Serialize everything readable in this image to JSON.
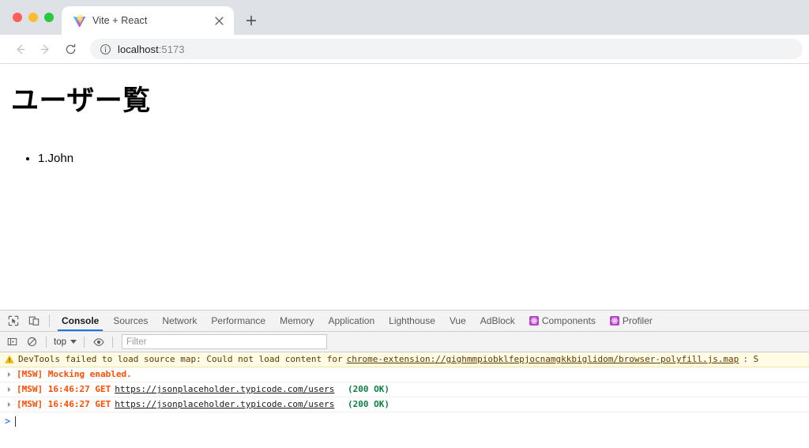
{
  "browser": {
    "traffic_lights": [
      "close",
      "minimize",
      "maximize"
    ],
    "tab": {
      "title": "Vite + React",
      "favicon": "vite-logo-icon",
      "close_label": "×"
    },
    "new_tab_label": "+",
    "nav": {
      "back": "back-arrow",
      "forward": "forward-arrow",
      "reload": "reload-arrow"
    },
    "omnibox": {
      "host": "localhost",
      "port": ":5173",
      "info_icon": "info-circle-icon"
    }
  },
  "page": {
    "title": "ユーザー覧",
    "users": [
      "1.John"
    ]
  },
  "devtools": {
    "left_icons": [
      "inspect-element-icon",
      "device-toolbar-icon"
    ],
    "tabs": [
      {
        "label": "Console",
        "active": true,
        "ext_icon": false
      },
      {
        "label": "Sources",
        "active": false,
        "ext_icon": false
      },
      {
        "label": "Network",
        "active": false,
        "ext_icon": false
      },
      {
        "label": "Performance",
        "active": false,
        "ext_icon": false
      },
      {
        "label": "Memory",
        "active": false,
        "ext_icon": false
      },
      {
        "label": "Application",
        "active": false,
        "ext_icon": false
      },
      {
        "label": "Lighthouse",
        "active": false,
        "ext_icon": false
      },
      {
        "label": "Vue",
        "active": false,
        "ext_icon": false
      },
      {
        "label": "AdBlock",
        "active": false,
        "ext_icon": false
      },
      {
        "label": "Components",
        "active": false,
        "ext_icon": true
      },
      {
        "label": "Profiler",
        "active": false,
        "ext_icon": true
      }
    ],
    "toolbar": {
      "sidebar_icon": "console-sidebar-icon",
      "clear_icon": "clear-console-icon",
      "context": "top",
      "eye_icon": "live-expression-eye-icon",
      "filter_placeholder": "Filter"
    },
    "console": {
      "messages": [
        {
          "kind": "warning",
          "icon": "warning-triangle-icon",
          "text_before": "DevTools failed to load source map: Could not load content for ",
          "link": "chrome-extension://gighmmpiobklfepjocnamgkkbiglidom/browser-polyfill.js.map",
          "text_after": ": S"
        },
        {
          "kind": "log",
          "icon": "expand-arrow-icon",
          "text": "[MSW] Mocking enabled."
        },
        {
          "kind": "network",
          "icon": "expand-arrow-icon",
          "prefix": "[MSW] 16:46:27 GET ",
          "link": "https://jsonplaceholder.typicode.com/users",
          "status": "(200 OK)"
        },
        {
          "kind": "network",
          "icon": "expand-arrow-icon",
          "prefix": "[MSW] 16:46:27 GET ",
          "link": "https://jsonplaceholder.typicode.com/users",
          "status": "(200 OK)"
        }
      ],
      "prompt_symbol": ">"
    }
  },
  "colors": {
    "accent": "#1a73e8",
    "msw_orange": "#ff4d00",
    "status_green": "#0b8043",
    "ext_purple": "#b544c6",
    "warning_bg": "#fffbe5"
  }
}
